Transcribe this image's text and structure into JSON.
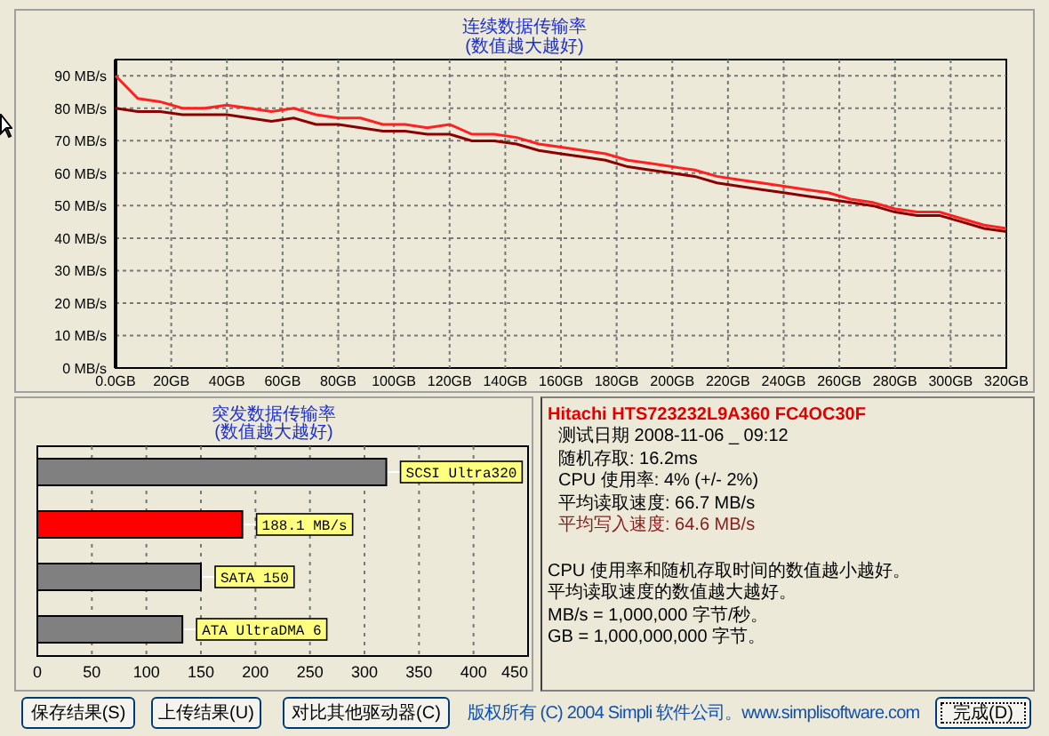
{
  "sequential": {
    "title": "连续数据传输率",
    "subtitle": "(数值越大越好)",
    "chart_data": {
      "type": "line",
      "x": [
        0,
        8,
        16,
        24,
        32,
        40,
        48,
        56,
        64,
        72,
        80,
        88,
        96,
        104,
        112,
        120,
        128,
        136,
        144,
        152,
        160,
        168,
        176,
        184,
        192,
        200,
        208,
        216,
        224,
        232,
        240,
        248,
        256,
        264,
        272,
        280,
        288,
        296,
        304,
        312,
        320
      ],
      "series": [
        {
          "color": "#ff2020",
          "values": [
            90,
            83,
            82,
            80,
            80,
            81,
            80,
            79,
            80,
            78,
            77,
            77,
            75,
            75,
            74,
            75,
            72,
            72,
            71,
            69,
            68,
            67,
            66,
            64,
            63,
            62,
            61,
            59,
            58,
            57,
            56,
            55,
            54,
            52,
            51,
            49,
            48,
            48,
            46,
            44,
            43
          ]
        },
        {
          "color": "#8b0000",
          "values": [
            80,
            79,
            79,
            78,
            78,
            78,
            77,
            76,
            77,
            75,
            75,
            74,
            73,
            73,
            72,
            72,
            70,
            70,
            69,
            67,
            66,
            65,
            64,
            62,
            61,
            60,
            59,
            57,
            56,
            55,
            54,
            53,
            52,
            51,
            50,
            48,
            47,
            47,
            45,
            43,
            42
          ]
        }
      ],
      "xlim": [
        0,
        320
      ],
      "ylim": [
        0,
        95
      ],
      "grid": true,
      "xticks": [
        {
          "value": 0,
          "label": "0.0GB"
        },
        {
          "value": 20,
          "label": "20GB"
        },
        {
          "value": 40,
          "label": "40GB"
        },
        {
          "value": 60,
          "label": "60GB"
        },
        {
          "value": 80,
          "label": "80GB"
        },
        {
          "value": 100,
          "label": "100GB"
        },
        {
          "value": 120,
          "label": "120GB"
        },
        {
          "value": 140,
          "label": "140GB"
        },
        {
          "value": 160,
          "label": "160GB"
        },
        {
          "value": 180,
          "label": "180GB"
        },
        {
          "value": 200,
          "label": "200GB"
        },
        {
          "value": 220,
          "label": "220GB"
        },
        {
          "value": 240,
          "label": "240GB"
        },
        {
          "value": 260,
          "label": "260GB"
        },
        {
          "value": 280,
          "label": "280GB"
        },
        {
          "value": 300,
          "label": "300GB"
        },
        {
          "value": 320,
          "label": "320GB"
        }
      ],
      "yticks": [
        {
          "value": 0,
          "label": "0 MB/s"
        },
        {
          "value": 10,
          "label": "10 MB/s"
        },
        {
          "value": 20,
          "label": "20 MB/s"
        },
        {
          "value": 30,
          "label": "30 MB/s"
        },
        {
          "value": 40,
          "label": "40 MB/s"
        },
        {
          "value": 50,
          "label": "50 MB/s"
        },
        {
          "value": 60,
          "label": "60 MB/s"
        },
        {
          "value": 70,
          "label": "70 MB/s"
        },
        {
          "value": 80,
          "label": "80 MB/s"
        },
        {
          "value": 90,
          "label": "90 MB/s"
        }
      ]
    }
  },
  "burst": {
    "title": "突发数据传输率",
    "subtitle": "(数值越大越好)",
    "chart_data": {
      "type": "bar",
      "orientation": "horizontal",
      "categories": [
        "SCSI Ultra320",
        "188.1 MB/s",
        "SATA 150",
        "ATA UltraDMA 6"
      ],
      "series": [
        {
          "color": "#808080",
          "values": [
            320,
            null,
            150,
            133
          ]
        },
        {
          "color": "#ff0000",
          "values": [
            null,
            188,
            null,
            null
          ]
        }
      ],
      "xlim": [
        0,
        450
      ],
      "xticks": [
        0,
        50,
        100,
        150,
        200,
        250,
        300,
        350,
        400,
        450
      ],
      "grid": true
    }
  },
  "info": {
    "drive": "Hitachi HTS723232L9A360 FC4OC30F",
    "lines": [
      {
        "text": "测试日期 2008-11-06 _ 09:12",
        "color": "#000000"
      },
      {
        "text": "随机存取: 16.2ms",
        "color": "#000000"
      },
      {
        "text": "CPU 使用率: 4% (+/- 2%)",
        "color": "#000000"
      },
      {
        "text": "平均读取速度: 66.7 MB/s",
        "color": "#000000"
      },
      {
        "text": "平均写入速度: 64.6 MB/s",
        "color": "#8b1a1a"
      }
    ],
    "notes": [
      "CPU 使用率和随机存取时间的数值越小越好。",
      "平均读取速度的数值越大越好。",
      "MB/s = 1,000,000 字节/秒。",
      "GB = 1,000,000,000 字节。"
    ]
  },
  "buttons": [
    {
      "label": "保存结果(S)",
      "focused": false
    },
    {
      "label": "上传结果(U)",
      "focused": false
    },
    {
      "label": "对比其他驱动器(C)",
      "focused": false
    }
  ],
  "copyright": "版权所有 (C) 2004 Simpli 软件公司。www.simplisoftware.com",
  "done_button": {
    "label": "完成(D)",
    "focused": true
  }
}
